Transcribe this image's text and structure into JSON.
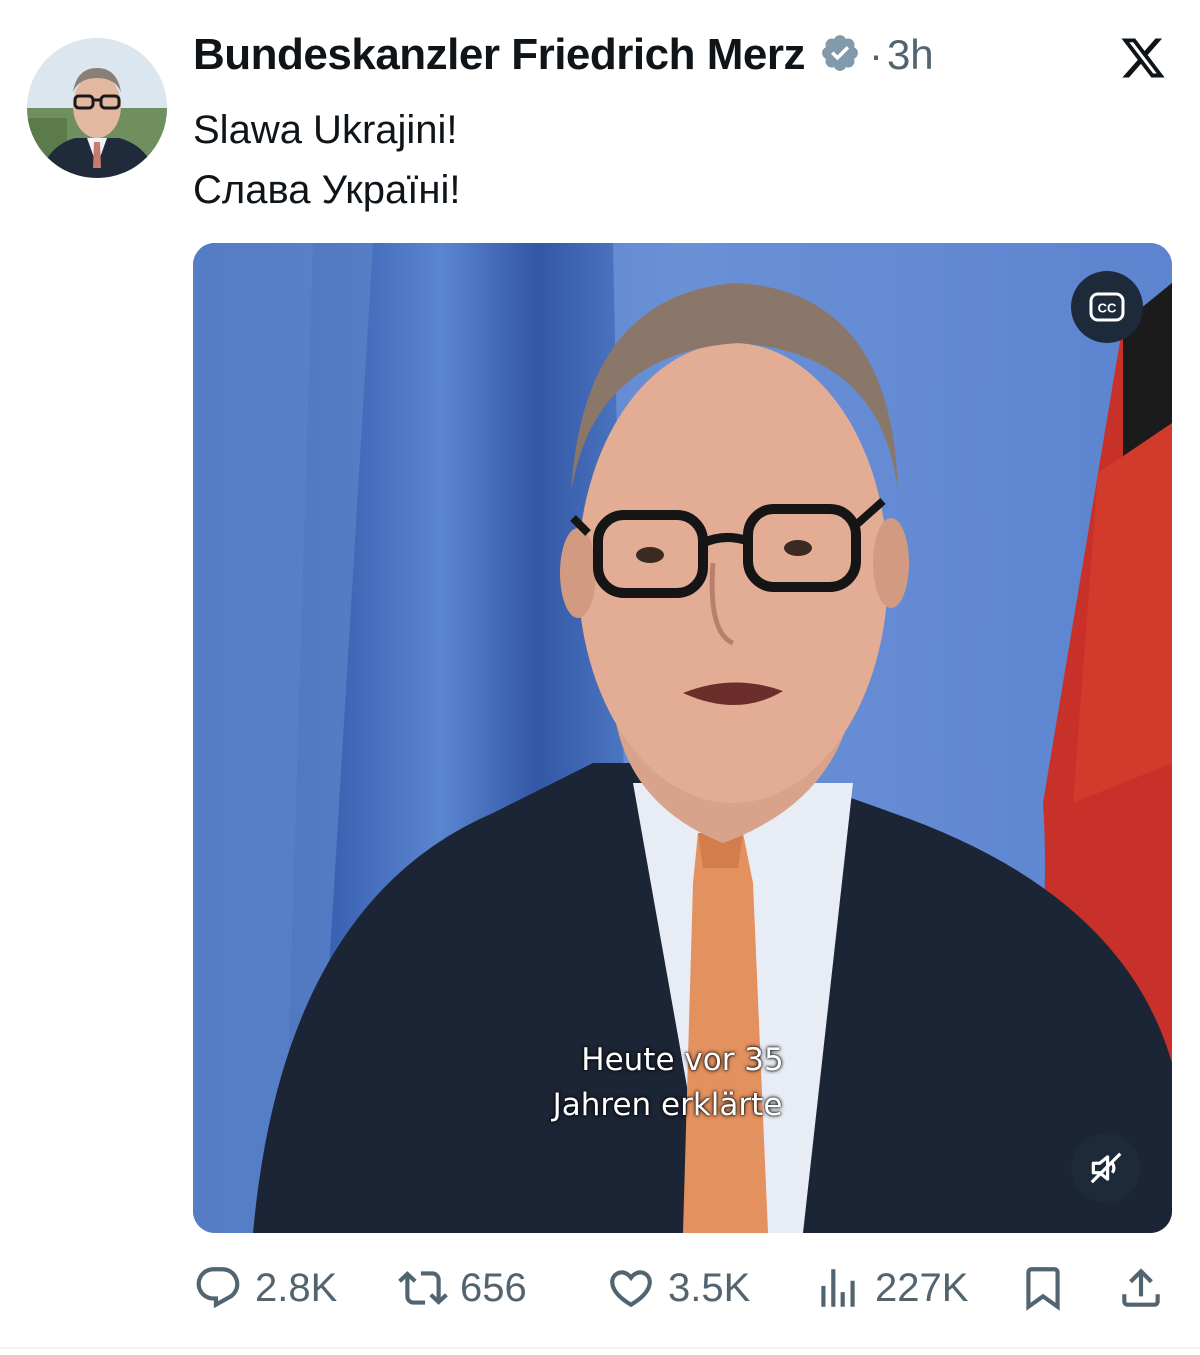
{
  "post": {
    "author_name": "Bundeskanzler Friedrich Merz",
    "time_separator": "·",
    "time": "3h",
    "text_lines": [
      "Slawa Ukrajini!",
      "Слава Україні!"
    ]
  },
  "media": {
    "subtitle_line1": "Heute vor 35",
    "subtitle_line2": "Jahren erklärte",
    "cc_label": "CC"
  },
  "actions": {
    "replies": "2.8K",
    "reposts": "656",
    "likes": "3.5K",
    "views": "227K"
  },
  "icons": {
    "verified": "verified-badge-icon",
    "platform": "x-logo-icon",
    "reply": "reply-icon",
    "repost": "repost-icon",
    "like": "heart-icon",
    "views": "views-icon",
    "bookmark": "bookmark-icon",
    "share": "share-icon",
    "captions": "closed-captions-icon",
    "mute": "muted-speaker-icon"
  },
  "colors": {
    "text": "#0f1419",
    "secondary": "#536471",
    "verified": "#829aab",
    "video_background": "#4f79c4"
  }
}
